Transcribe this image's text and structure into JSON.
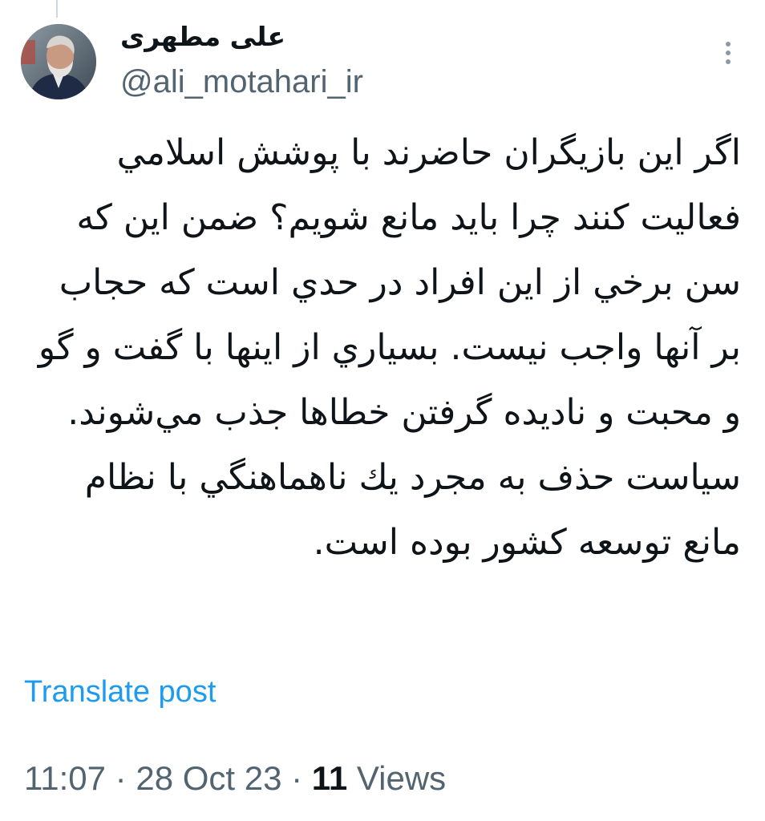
{
  "author": {
    "display_name": "علی مطهری",
    "handle": "@ali_motahari_ir",
    "avatar_icon": "profile-photo"
  },
  "more_icon": "more-vertical-icon",
  "tweet": {
    "text": "اگر اين بازيگران حاضرند با پوشش اسلامي فعاليت كنند چرا بايد مانع شويم؟ ضمن اين كه سن برخي از اين افراد در حدي است كه حجاب بر آنها واجب نيست. بسياري از اينها با گفت و گو و محبت و ناديده گرفتن خطاها جذب مي‌شوند. سياست حذف به مجرد يك ناهماهنگي با نظام مانع توسعه كشور بوده است."
  },
  "translate_label": "Translate post",
  "meta": {
    "time": "11:07",
    "separator": "·",
    "date": "28 Oct 23",
    "views_count": "11",
    "views_label": "Views"
  },
  "colors": {
    "link": "#1d9bf0",
    "secondary_text": "#536471",
    "primary_text": "#0f1419"
  }
}
